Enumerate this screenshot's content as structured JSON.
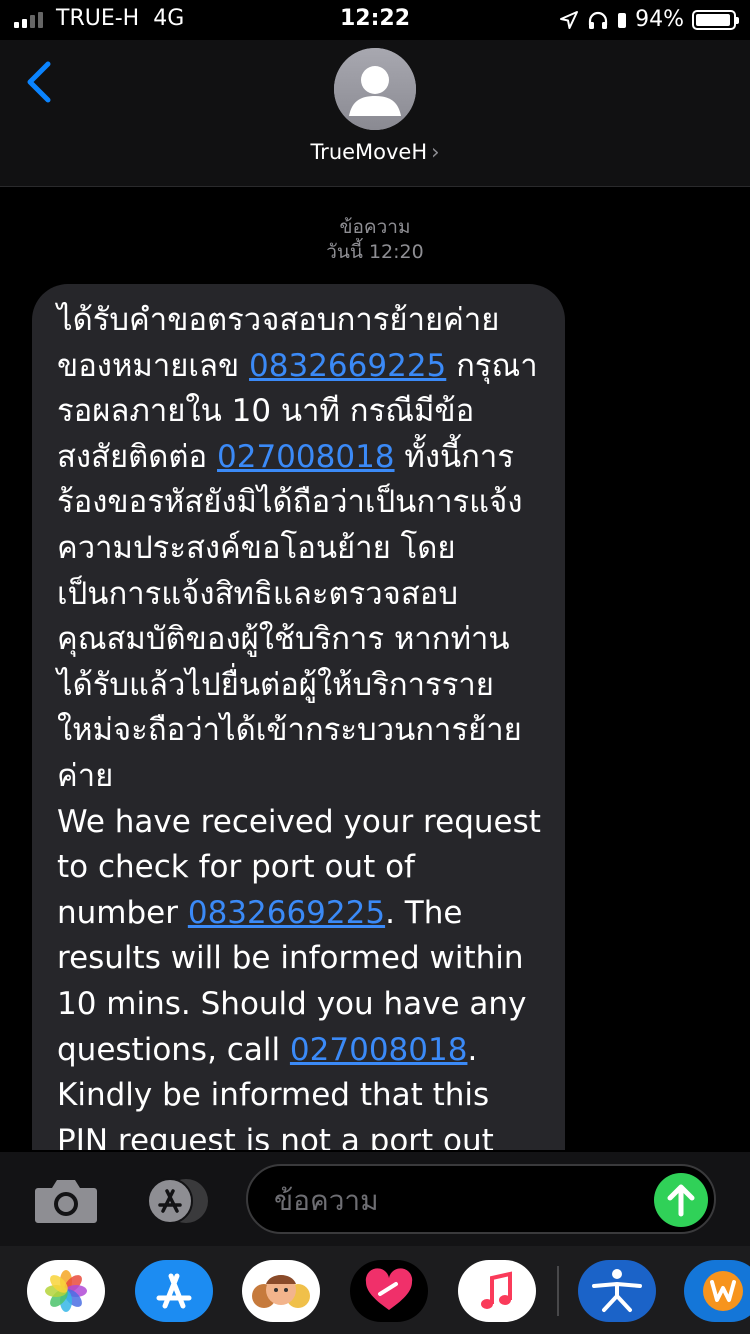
{
  "status_bar": {
    "carrier": "TRUE-H",
    "network": "4G",
    "time": "12:22",
    "battery_percent": "94%",
    "battery_level": 0.94,
    "signal_bars": 4
  },
  "header": {
    "back_icon": "chevron-left-icon",
    "contact_name": "TrueMoveH",
    "contact_chevron": "›"
  },
  "thread": {
    "label": "ข้อความ",
    "timestamp": "วันนี้ 12:20",
    "message": {
      "th_1": "ได้รับคำขอตรวจสอบการย้ายค่ายของหมายเลข ",
      "number": "0832669225",
      "th_2": " กรุณารอผลภายใน 10 นาที กรณีมีข้อสงสัยติดต่อ ",
      "phone": "027008018",
      "th_3": " ทั้งนี้การร้องขอรหัสยังมิได้ถือว่าเป็นการแจ้งความประสงค์ขอโอนย้าย โดยเป็นการแจ้งสิทธิและตรวจสอบคุณสมบัติของผู้ใช้บริการ หากท่านได้รับแล้วไปยื่นต่อผู้ให้บริการรายใหม่จะถือว่าได้เข้ากระบวนการย้ายค่าย",
      "en_1": "We have received your request to check for port out of number ",
      "en_number": "0832669225",
      "en_2": ". The results will be informed within 10 mins. Should you have any questions, call ",
      "en_phone": "027008018",
      "en_3": ". Kindly be informed that this PIN request is not a port out request. MNP"
    }
  },
  "input_bar": {
    "camera_icon": "camera-icon",
    "appstore_icon": "app-store-icon",
    "placeholder": "ข้อความ",
    "send_icon": "arrow-up-icon"
  },
  "app_drawer": {
    "apps": [
      "photos-icon",
      "app-store-icon",
      "memoji-icon",
      "heart-sticker-icon",
      "music-icon",
      "fitness-icon",
      "w-app-icon"
    ]
  },
  "colors": {
    "link": "#3b8af7",
    "send": "#30d158",
    "bubble": "#26262a",
    "ios_blue": "#0a84ff"
  }
}
